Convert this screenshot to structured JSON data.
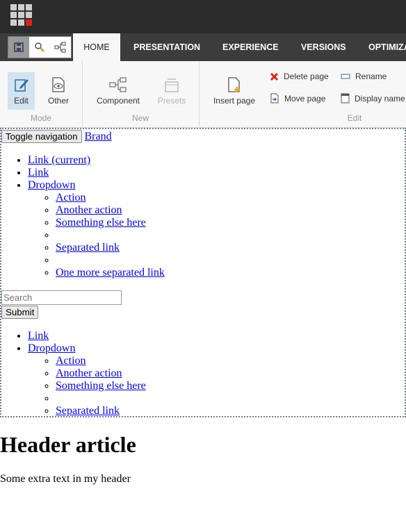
{
  "tabs": [
    "HOME",
    "PRESENTATION",
    "EXPERIENCE",
    "VERSIONS",
    "OPTIMIZA"
  ],
  "ribbon": {
    "mode": {
      "label": "Mode",
      "edit": "Edit",
      "other": "Other"
    },
    "new": {
      "label": "New",
      "component": "Component",
      "presets": "Presets"
    },
    "edit": {
      "label": "Edit",
      "insert_page": "Insert page",
      "delete_page": "Delete page",
      "move_page": "Move page",
      "rename": "Rename",
      "display_name": "Display name"
    }
  },
  "navbar": {
    "toggle": "Toggle navigation",
    "brand": "Brand",
    "links": [
      "Link (current)",
      "Link",
      "Dropdown"
    ],
    "dropdown": [
      "Action",
      "Another action",
      "Something else here",
      "",
      "Separated link",
      "",
      "One more separated link"
    ],
    "search_placeholder": "Search",
    "submit": "Submit",
    "links2": [
      "Link",
      "Dropdown"
    ],
    "dropdown2": [
      "Action",
      "Another action",
      "Something else here",
      "",
      "Separated link"
    ]
  },
  "article": {
    "title": "Header article",
    "text": "Some extra text in my header"
  },
  "colors": {
    "topbar": "#2b2b2b",
    "tabrow": "#3c3c3c",
    "ribbon": "#f7f7f7",
    "selected": "#d1e4ef",
    "delete_red": "#e0201b"
  }
}
